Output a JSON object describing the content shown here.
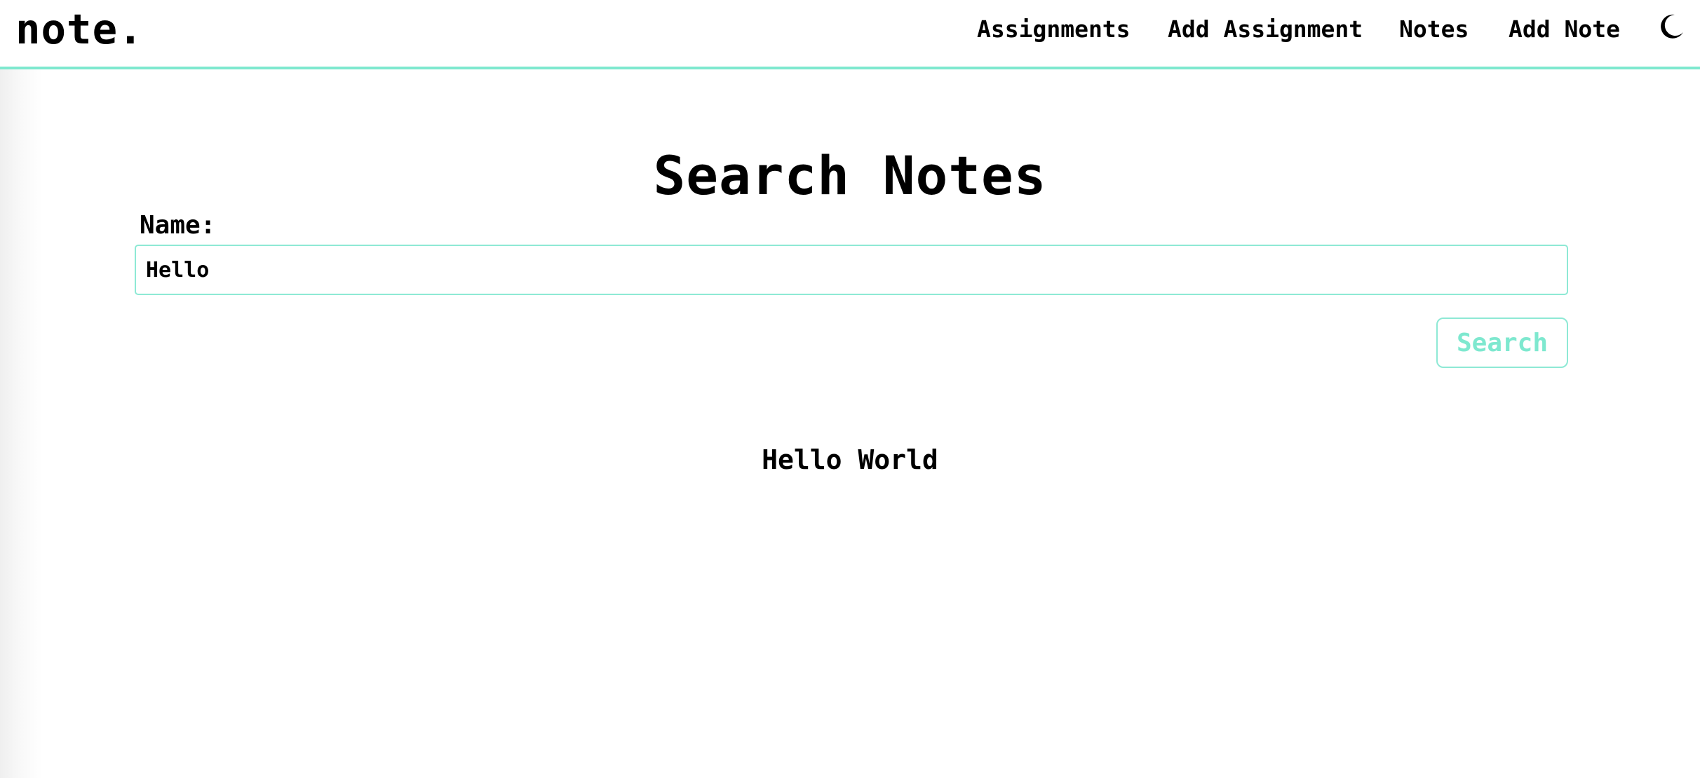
{
  "header": {
    "brand": "note.",
    "nav": [
      {
        "label": "Assignments"
      },
      {
        "label": "Add Assignment"
      },
      {
        "label": "Notes"
      },
      {
        "label": "Add Note"
      }
    ],
    "theme_icon": "moon-icon"
  },
  "main": {
    "title": "Search Notes",
    "name_label": "Name:",
    "search_value": "Hello",
    "search_button": "Search",
    "results": [
      {
        "title": "Hello World"
      }
    ]
  },
  "colors": {
    "accent": "#7ee8cf",
    "text": "#000000",
    "background": "#ffffff"
  }
}
